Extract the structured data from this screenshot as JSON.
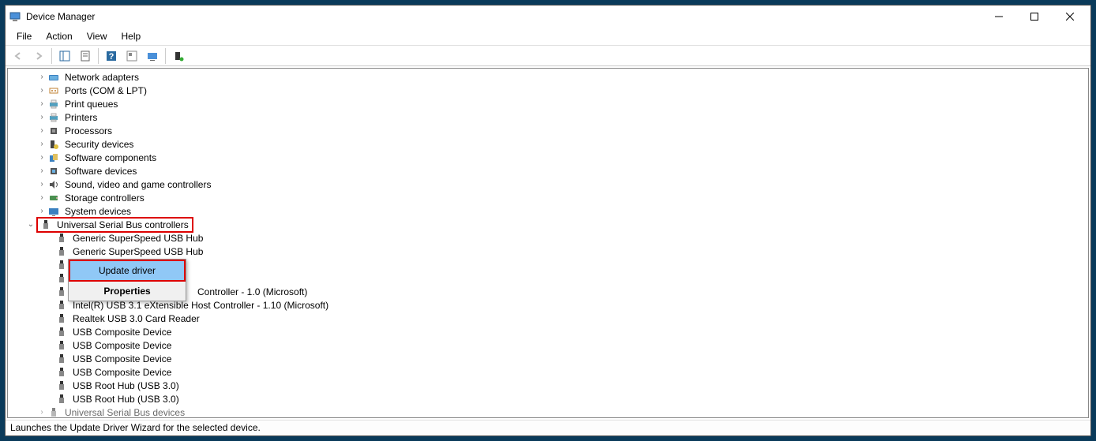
{
  "window": {
    "title": "Device Manager"
  },
  "menu": {
    "file": "File",
    "action": "Action",
    "view": "View",
    "help": "Help"
  },
  "tree": {
    "categories": [
      {
        "label": "Network adapters",
        "icon": "network"
      },
      {
        "label": "Ports (COM & LPT)",
        "icon": "port"
      },
      {
        "label": "Print queues",
        "icon": "printer"
      },
      {
        "label": "Printers",
        "icon": "printer"
      },
      {
        "label": "Processors",
        "icon": "cpu"
      },
      {
        "label": "Security devices",
        "icon": "security"
      },
      {
        "label": "Software components",
        "icon": "software"
      },
      {
        "label": "Software devices",
        "icon": "software"
      },
      {
        "label": "Sound, video and game controllers",
        "icon": "sound"
      },
      {
        "label": "Storage controllers",
        "icon": "storage"
      },
      {
        "label": "System devices",
        "icon": "system"
      }
    ],
    "usb_category": {
      "label": "Universal Serial Bus controllers"
    },
    "usb_children": [
      {
        "label": "Generic SuperSpeed USB Hub"
      },
      {
        "label": "Generic SuperSpeed USB Hub"
      },
      {
        "label_tail": ""
      },
      {
        "label_tail": ""
      },
      {
        "label_tail": "Controller - 1.0 (Microsoft)"
      },
      {
        "label": "Intel(R) USB 3.1 eXtensible Host Controller - 1.10 (Microsoft)"
      },
      {
        "label": "Realtek USB 3.0 Card Reader"
      },
      {
        "label": "USB Composite Device"
      },
      {
        "label": "USB Composite Device"
      },
      {
        "label": "USB Composite Device"
      },
      {
        "label": "USB Composite Device"
      },
      {
        "label": "USB Root Hub (USB 3.0)"
      },
      {
        "label": "USB Root Hub (USB 3.0)"
      }
    ],
    "usb_devices_category": {
      "label": "Universal Serial Bus devices"
    }
  },
  "context_menu": {
    "update": "Update driver",
    "properties": "Properties"
  },
  "status_bar": {
    "text": "Launches the Update Driver Wizard for the selected device."
  }
}
